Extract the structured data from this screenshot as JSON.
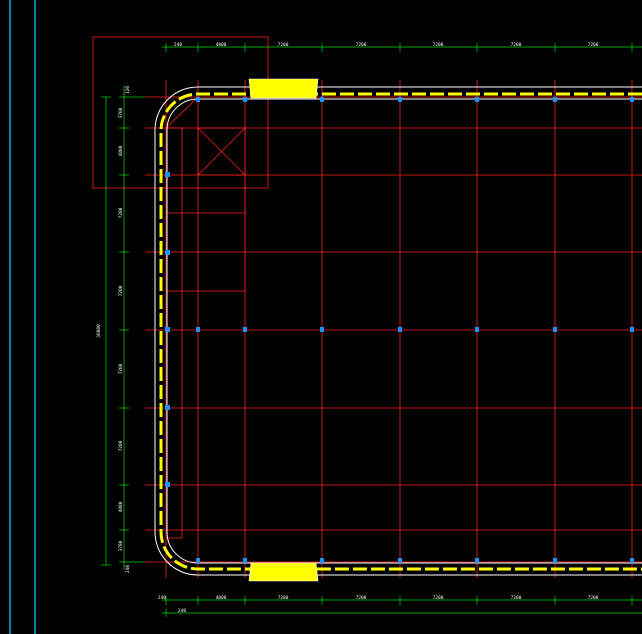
{
  "colors": {
    "background": "#000000",
    "grid": "#ff2020",
    "dimension": "#00e000",
    "border": "#00e5ff",
    "wall": "#ffff00",
    "column_mark": "#1e90ff",
    "text": "#ffffff"
  },
  "dimensions": {
    "top": [
      "240",
      "4800",
      "7200",
      "7200",
      "7200",
      "7200",
      "7200"
    ],
    "bottom_row1": [
      "240",
      "4800",
      "7200",
      "7200",
      "7200",
      "7200",
      "7200"
    ],
    "bottom_row2": [
      "240"
    ],
    "left": [
      "120",
      "3700",
      "4800",
      "7200",
      "7200",
      "7200",
      "7200",
      "4800",
      "3700",
      "240"
    ],
    "left_total": "36000"
  }
}
